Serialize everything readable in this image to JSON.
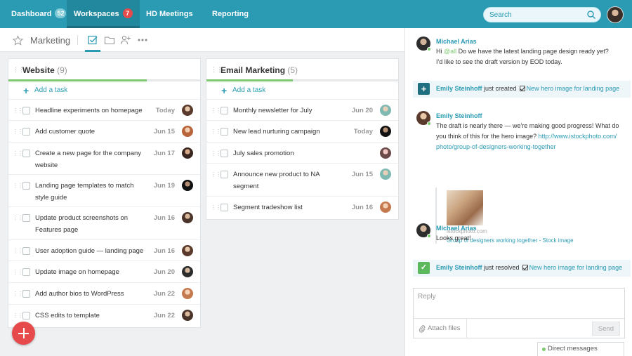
{
  "nav": {
    "items": [
      {
        "label": "Dashboard",
        "badge": "52"
      },
      {
        "label": "Workspaces",
        "badge": "7"
      },
      {
        "label": "HD Meetings"
      },
      {
        "label": "Reporting"
      }
    ],
    "search_placeholder": "Search"
  },
  "subheader": {
    "title": "Marketing"
  },
  "colors": {
    "brand": "#2a9bb3",
    "accent": "#e64a4a",
    "success": "#7dc870"
  },
  "boards": [
    {
      "title": "Website",
      "count": "(9)",
      "progress": 0.72,
      "add_label": "Add a task",
      "tasks": [
        {
          "title": "Headline experiments on homepage",
          "date": "Today"
        },
        {
          "title": "Add customer quote",
          "date": "Jun 15"
        },
        {
          "title": "Create a new page for the company website",
          "date": "Jun 17"
        },
        {
          "title": "Landing page templates to match style guide",
          "date": "Jun 19"
        },
        {
          "title": "Update product screenshots on Features page",
          "date": "Jun 16"
        },
        {
          "title": "User adoption guide — landing page",
          "date": "Jun 16"
        },
        {
          "title": "Update image on homepage",
          "date": "Jun 20"
        },
        {
          "title": "Add author bios to WordPress",
          "date": "Jun 22"
        },
        {
          "title": "CSS edits to template",
          "date": "Jun 22"
        }
      ]
    },
    {
      "title": "Email Marketing",
      "count": "(5)",
      "progress": 0.45,
      "add_label": "Add a task",
      "tasks": [
        {
          "title": "Monthly newsletter for July",
          "date": "Jun 20"
        },
        {
          "title": "New lead nurturing campaign",
          "date": "Today"
        },
        {
          "title": "July sales promotion",
          "date": ""
        },
        {
          "title": "Announce new product to NA segment",
          "date": "Jun 15"
        },
        {
          "title": "Segment tradeshow list",
          "date": "Jun 16"
        }
      ]
    }
  ],
  "chat": {
    "messages": [
      {
        "author": "Michael Arias",
        "mention": "@all",
        "text_after": " Do we have the latest landing page design ready yet?",
        "line2": "I'd like to see the draft version by EOD today."
      },
      {
        "author": "Emily Steinhoff",
        "text": "The draft is nearly there — we're making good progress! What do you think of this for the hero image?",
        "url_part1": "http://www.istockphoto.com/",
        "url_part2": "photo/group-of-designers-working-together"
      },
      {
        "author": "Michael Arias",
        "text": "Looks great!"
      }
    ],
    "preview": {
      "source": "istockphoto.com",
      "title": "Group of designers working together - Stock image"
    },
    "activities": [
      {
        "user": "Emily Steinhoff",
        "action": "just created",
        "task": "New hero image for landing page",
        "icon": "+"
      },
      {
        "user": "Emily Steinhoff",
        "action": "just resolved",
        "task": "New hero image for landing page",
        "icon": "✓"
      }
    ],
    "reply_placeholder": "Reply",
    "attach_label": "Attach files",
    "send_label": "Send",
    "dm_label": "Direct messages"
  }
}
